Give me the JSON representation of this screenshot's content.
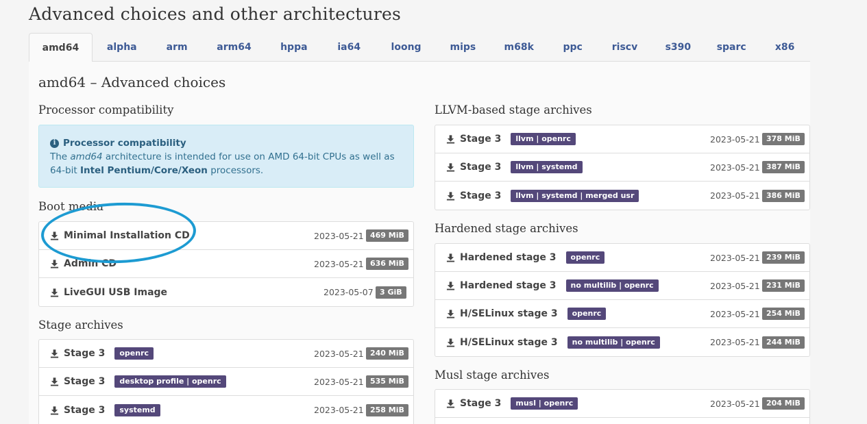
{
  "page": {
    "title": "Advanced choices and other architectures"
  },
  "tabs": [
    {
      "label": "amd64",
      "active": true
    },
    {
      "label": "alpha"
    },
    {
      "label": "arm"
    },
    {
      "label": "arm64"
    },
    {
      "label": "hppa"
    },
    {
      "label": "ia64"
    },
    {
      "label": "loong"
    },
    {
      "label": "mips"
    },
    {
      "label": "m68k"
    },
    {
      "label": "ppc"
    },
    {
      "label": "riscv"
    },
    {
      "label": "s390"
    },
    {
      "label": "sparc"
    },
    {
      "label": "x86"
    }
  ],
  "section": {
    "title": "amd64 – Advanced choices"
  },
  "processor": {
    "title": "Processor compatibility",
    "alert_title": "Processor compatibility",
    "text_before": "The ",
    "text_em": "amd64",
    "text_mid": " architecture is intended for use on AMD 64-bit CPUs as well as 64-bit ",
    "text_bold": "Intel Pentium/Core/Xeon",
    "text_after": " processors."
  },
  "boot_media": {
    "title": "Boot media",
    "items": [
      {
        "name": "Minimal Installation CD",
        "date": "2023-05-21",
        "size": "469 MiB"
      },
      {
        "name": "Admin CD",
        "date": "2023-05-21",
        "size": "636 MiB"
      },
      {
        "name": "LiveGUI USB Image",
        "date": "2023-05-07",
        "size": "3 GiB"
      }
    ]
  },
  "stage_archives": {
    "title": "Stage archives",
    "items": [
      {
        "name": "Stage 3",
        "tag": "openrc",
        "date": "2023-05-21",
        "size": "240 MiB"
      },
      {
        "name": "Stage 3",
        "tag": "desktop profile | openrc",
        "date": "2023-05-21",
        "size": "535 MiB"
      },
      {
        "name": "Stage 3",
        "tag": "systemd",
        "date": "2023-05-21",
        "size": "258 MiB"
      }
    ]
  },
  "llvm_archives": {
    "title": "LLVM-based stage archives",
    "items": [
      {
        "name": "Stage 3",
        "tag": "llvm | openrc",
        "date": "2023-05-21",
        "size": "378 MiB"
      },
      {
        "name": "Stage 3",
        "tag": "llvm | systemd",
        "date": "2023-05-21",
        "size": "387 MiB"
      },
      {
        "name": "Stage 3",
        "tag": "llvm | systemd | merged usr",
        "date": "2023-05-21",
        "size": "386 MiB"
      }
    ]
  },
  "hardened_archives": {
    "title": "Hardened stage archives",
    "items": [
      {
        "name": "Hardened stage 3",
        "tag": "openrc",
        "date": "2023-05-21",
        "size": "239 MiB"
      },
      {
        "name": "Hardened stage 3",
        "tag": "no multilib | openrc",
        "date": "2023-05-21",
        "size": "231 MiB"
      },
      {
        "name": "H/SELinux stage 3",
        "tag": "openrc",
        "date": "2023-05-21",
        "size": "254 MiB"
      },
      {
        "name": "H/SELinux stage 3",
        "tag": "no multilib | openrc",
        "date": "2023-05-21",
        "size": "244 MiB"
      }
    ]
  },
  "musl_archives": {
    "title": "Musl stage archives",
    "items": [
      {
        "name": "Stage 3",
        "tag": "musl | openrc",
        "date": "2023-05-21",
        "size": "204 MiB"
      }
    ]
  },
  "colors": {
    "link": "#3d5a95",
    "tag_bg": "#54487a",
    "size_bg": "#777777",
    "alert_bg": "#d9edf7",
    "annotation": "#1d9bd2"
  },
  "icons": {
    "download": "download-icon",
    "info": "info-icon"
  }
}
